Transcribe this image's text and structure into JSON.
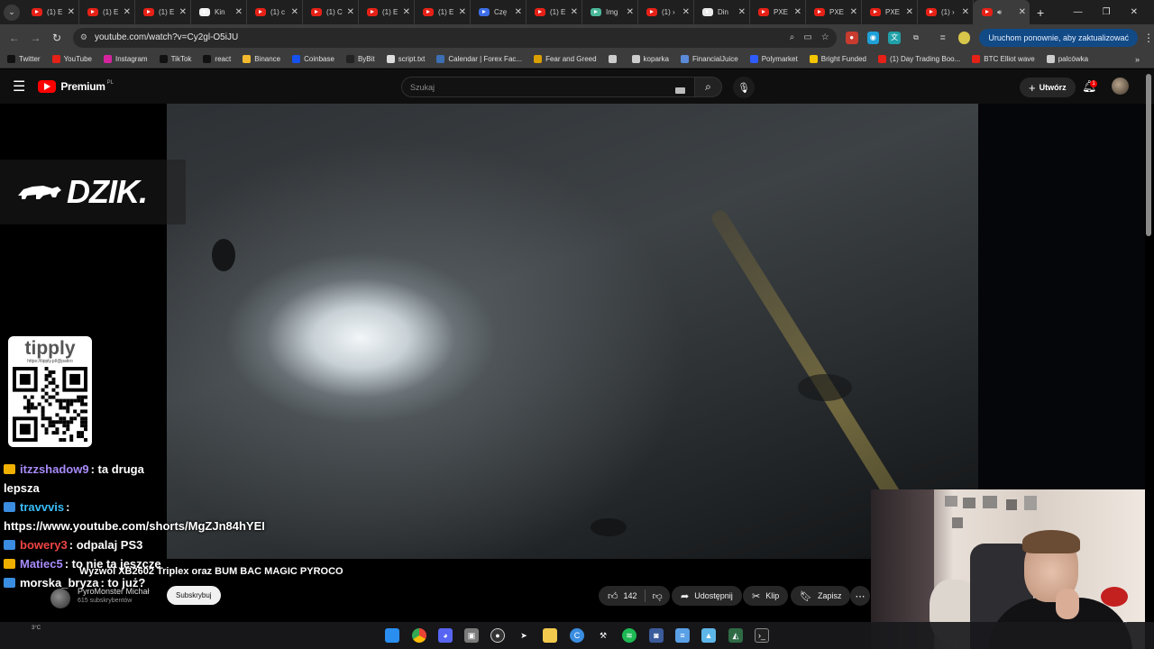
{
  "browser": {
    "tabs": [
      {
        "title": "(1) E",
        "favicon_color": "#e62117"
      },
      {
        "title": "(1) E",
        "favicon_color": "#e62117"
      },
      {
        "title": "(1) E",
        "favicon_color": "#e62117"
      },
      {
        "title": "Kin",
        "favicon_color": "#f2f2f2"
      },
      {
        "title": "(1) c",
        "favicon_color": "#e62117"
      },
      {
        "title": "(1) C",
        "favicon_color": "#e62117"
      },
      {
        "title": "(1) E",
        "favicon_color": "#e62117"
      },
      {
        "title": "(1) E",
        "favicon_color": "#e62117"
      },
      {
        "title": "Czę",
        "favicon_color": "#3d6ee8"
      },
      {
        "title": "(1) E",
        "favicon_color": "#e62117"
      },
      {
        "title": "Img",
        "favicon_color": "#4bb89a"
      },
      {
        "title": "(1) ›",
        "favicon_color": "#e62117"
      },
      {
        "title": "Din",
        "favicon_color": "#e9e9e9"
      },
      {
        "title": "PXE",
        "favicon_color": "#e62117"
      },
      {
        "title": "PXE",
        "favicon_color": "#e62117"
      },
      {
        "title": "PXE",
        "favicon_color": "#e62117"
      },
      {
        "title": "(1) ›",
        "favicon_color": "#e62117"
      }
    ],
    "address": {
      "url": "youtube.com/watch?v=Cy2gl-O5iJU",
      "update_label": "Uruchom ponownie, aby zaktualizować"
    },
    "bookmarks": [
      {
        "label": "Twitter",
        "color": "#111111"
      },
      {
        "label": "YouTube",
        "color": "#e62117"
      },
      {
        "label": "Instagram",
        "color": "#d6249f"
      },
      {
        "label": "TikTok",
        "color": "#111111"
      },
      {
        "label": "react",
        "color": "#111111"
      },
      {
        "label": "Binance",
        "color": "#f3ba2f"
      },
      {
        "label": "Coinbase",
        "color": "#1652f0"
      },
      {
        "label": "ByBit",
        "color": "#222222"
      },
      {
        "label": "script.txt",
        "color": "#dddddd"
      },
      {
        "label": "Calendar | Forex Fac...",
        "color": "#3c6fb4"
      },
      {
        "label": "Fear and Greed",
        "color": "#d9a000"
      },
      {
        "label": "",
        "color": "#cccccc"
      },
      {
        "label": "koparka",
        "color": "#cccccc"
      },
      {
        "label": "FinancialJuice",
        "color": "#5b8ad8"
      },
      {
        "label": "Polymarket",
        "color": "#2e5cff"
      },
      {
        "label": "Bright Funded",
        "color": "#f3c500"
      },
      {
        "label": "(1) Day Trading Boo...",
        "color": "#e62117"
      },
      {
        "label": "BTC Elliot wave",
        "color": "#e62117"
      },
      {
        "label": "palcówka",
        "color": "#cccccc"
      }
    ]
  },
  "youtube": {
    "logo_word": "Premium",
    "country_code": "PL",
    "search_placeholder": "Szukaj",
    "create_label": "Utwórz",
    "notification_count": "1"
  },
  "video": {
    "overlay_brand": "DZIK.",
    "tipply_logo": "tipply",
    "tipply_url": "https://tipply.pl/@patiro",
    "chat": [
      {
        "user": "itzzshadow9",
        "text": ": ta druga lepsza",
        "user_color": "#a78bfa",
        "badge_color": "#f0b000"
      },
      {
        "user": "travvvis",
        "text": ": https://www.youtube.com/shorts/MgZJn84hYEI",
        "user_color": "#38bdf8",
        "badge_color": "#3a8de0"
      },
      {
        "user": "bowery3",
        "text": ": odpalaj PS3",
        "user_color": "#ef4444",
        "badge_color": "#3a8de0"
      },
      {
        "user": "Matiec5",
        "text": ": to nie ta jeszcze",
        "user_color": "#a78bfa",
        "badge_color": "#f0b000"
      },
      {
        "user": "morska_bryza",
        "text": ": to już?",
        "user_color": "#ffffff",
        "badge_color": "#3a8de0"
      }
    ],
    "title": "Wyzwól XB2602 Triplex oraz BUM BAC MAGIC PYROCO",
    "channel_name": "PyroMonster Michał",
    "channel_subs": "615 subskrybentów",
    "subscribe_label": "Subskrybuj",
    "likes": "142",
    "share_label": "Udostępnij",
    "clip_label": "Klip",
    "save_label": "Zapisz"
  },
  "taskbar": {
    "weather_temp": "3°C"
  }
}
